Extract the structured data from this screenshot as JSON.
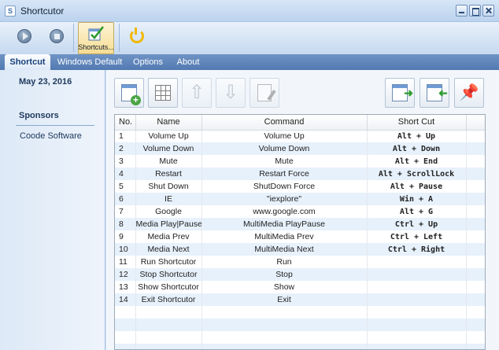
{
  "window": {
    "title": "Shortcutor",
    "icon_letter": "S"
  },
  "ribbon": {
    "shortcuts_label": "Shortcuts..."
  },
  "tabs": [
    "Shortcut",
    "Windows Default",
    "Options",
    "About"
  ],
  "sidebar": {
    "date": "May 23, 2016",
    "sponsors_title": "Sponsors",
    "sponsor_item": "Coode Software"
  },
  "table": {
    "headers": [
      "No.",
      "Name",
      "Command",
      "Short Cut"
    ],
    "rows": [
      [
        "1",
        "Volume Up",
        "Volume Up",
        "Alt + Up"
      ],
      [
        "2",
        "Volume Down",
        "Volume Down",
        "Alt + Down"
      ],
      [
        "3",
        "Mute",
        "Mute",
        "Alt + End"
      ],
      [
        "4",
        "Restart",
        "Restart Force",
        "Alt + ScrollLock"
      ],
      [
        "5",
        "Shut Down",
        "ShutDown Force",
        "Alt + Pause"
      ],
      [
        "6",
        "IE",
        "\"iexplore\"",
        "Win + A"
      ],
      [
        "7",
        "Google",
        "www.google.com",
        "Alt + G"
      ],
      [
        "8",
        "Media Play|Pause",
        "MultiMedia PlayPause",
        "Ctrl + Up"
      ],
      [
        "9",
        "Media Prev",
        "MultiMedia Prev",
        "Ctrl + Left"
      ],
      [
        "10",
        "Media Next",
        "MultiMedia Next",
        "Ctrl + Right"
      ],
      [
        "11",
        "Run Shortcutor",
        "Run",
        ""
      ],
      [
        "12",
        "Stop Shortcutor",
        "Stop",
        ""
      ],
      [
        "13",
        "Show Shortcutor",
        "Show",
        ""
      ],
      [
        "14",
        "Exit Shortcutor",
        "Exit",
        ""
      ]
    ]
  },
  "colors": {
    "accent": "#527ab2",
    "row_alt": "#e7f1fc",
    "power": "#f1b800"
  }
}
